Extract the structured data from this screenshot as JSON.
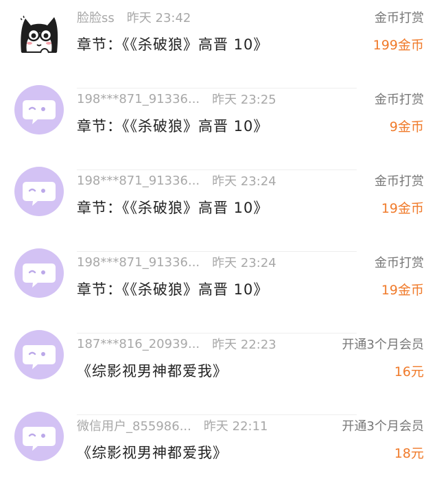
{
  "colors": {
    "amount": "#f07a2a",
    "avatar_bg": "#d3c2f4",
    "meta_text": "#a8a8a8",
    "primary_text": "#222222"
  },
  "records": [
    {
      "avatar_icon": "cartoon-cat-avatar",
      "username": "脸脸ss",
      "time": "昨天 23:42",
      "content": "章节：《《杀破狼》高晋 10》",
      "type": "金币打赏",
      "amount": "199金币"
    },
    {
      "avatar_icon": "default-chat-bubble-avatar",
      "username": "198***871_91336...",
      "time": "昨天 23:25",
      "content": "章节：《《杀破狼》高晋 10》",
      "type": "金币打赏",
      "amount": "9金币"
    },
    {
      "avatar_icon": "default-chat-bubble-avatar",
      "username": "198***871_91336...",
      "time": "昨天 23:24",
      "content": "章节：《《杀破狼》高晋 10》",
      "type": "金币打赏",
      "amount": "19金币"
    },
    {
      "avatar_icon": "default-chat-bubble-avatar",
      "username": "198***871_91336...",
      "time": "昨天 23:24",
      "content": "章节：《《杀破狼》高晋 10》",
      "type": "金币打赏",
      "amount": "19金币"
    },
    {
      "avatar_icon": "default-chat-bubble-avatar",
      "username": "187***816_20939...",
      "time": "昨天 22:23",
      "content": "《综影视男神都爱我》",
      "type": "开通3个月会员",
      "amount": "16元"
    },
    {
      "avatar_icon": "default-chat-bubble-avatar",
      "username": "微信用户_855986...",
      "time": "昨天 22:11",
      "content": "《综影视男神都爱我》",
      "type": "开通3个月会员",
      "amount": "18元"
    }
  ]
}
